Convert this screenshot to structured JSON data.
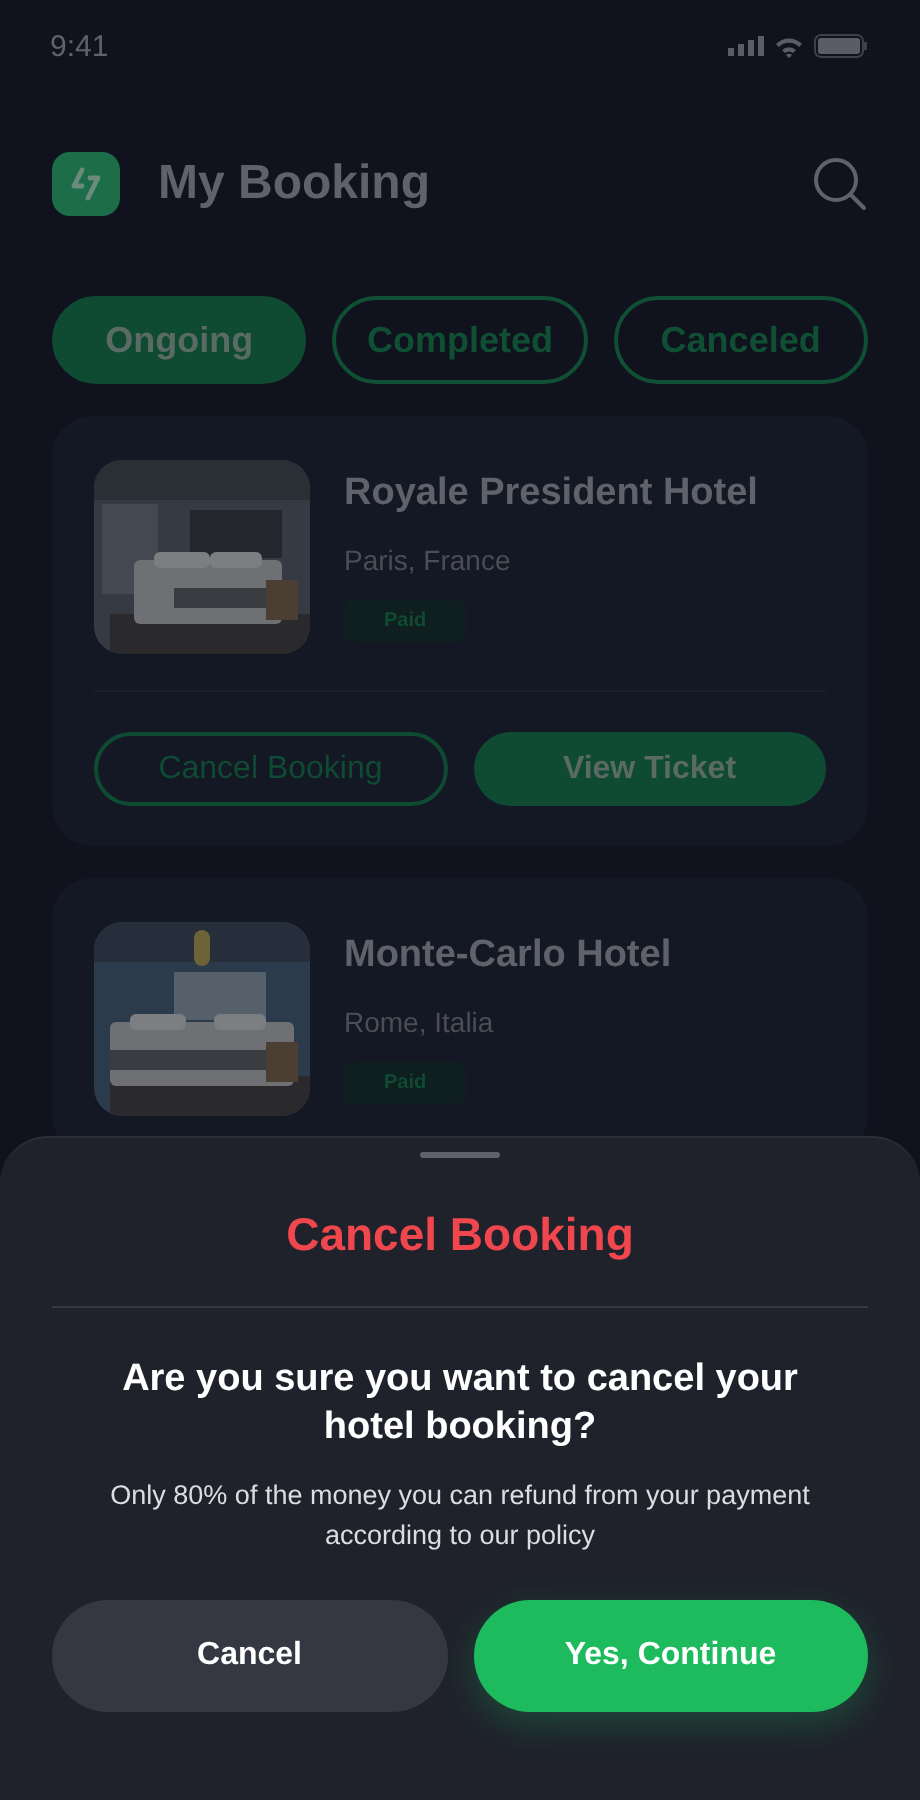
{
  "status_bar": {
    "time": "9:41"
  },
  "header": {
    "title": "My Booking"
  },
  "tabs": [
    {
      "label": "Ongoing",
      "selected": true
    },
    {
      "label": "Completed",
      "selected": false
    },
    {
      "label": "Canceled",
      "selected": false
    }
  ],
  "bookings": [
    {
      "name": "Royale President Hotel",
      "location": "Paris, France",
      "status": "Paid",
      "picture": {
        "kind": "picture"
      },
      "buttons": [
        {
          "label": "Cancel Booking",
          "kind": "outline"
        },
        {
          "label": "View Ticket",
          "kind": "filled"
        }
      ]
    },
    {
      "name": "Monte-Carlo Hotel",
      "location": "Rome, Italia",
      "status": "Paid",
      "picture": {
        "kind": "picture"
      }
    }
  ],
  "sheet": {
    "title": "Cancel Booking",
    "question": "Are you sure you want to cancel your hotel booking?",
    "message": "Only 80% of the money you can refund from your payment according to our policy",
    "buttons": [
      {
        "label": "Cancel",
        "kind": "secondary"
      },
      {
        "label": "Yes, Continue",
        "kind": "primary"
      }
    ]
  }
}
